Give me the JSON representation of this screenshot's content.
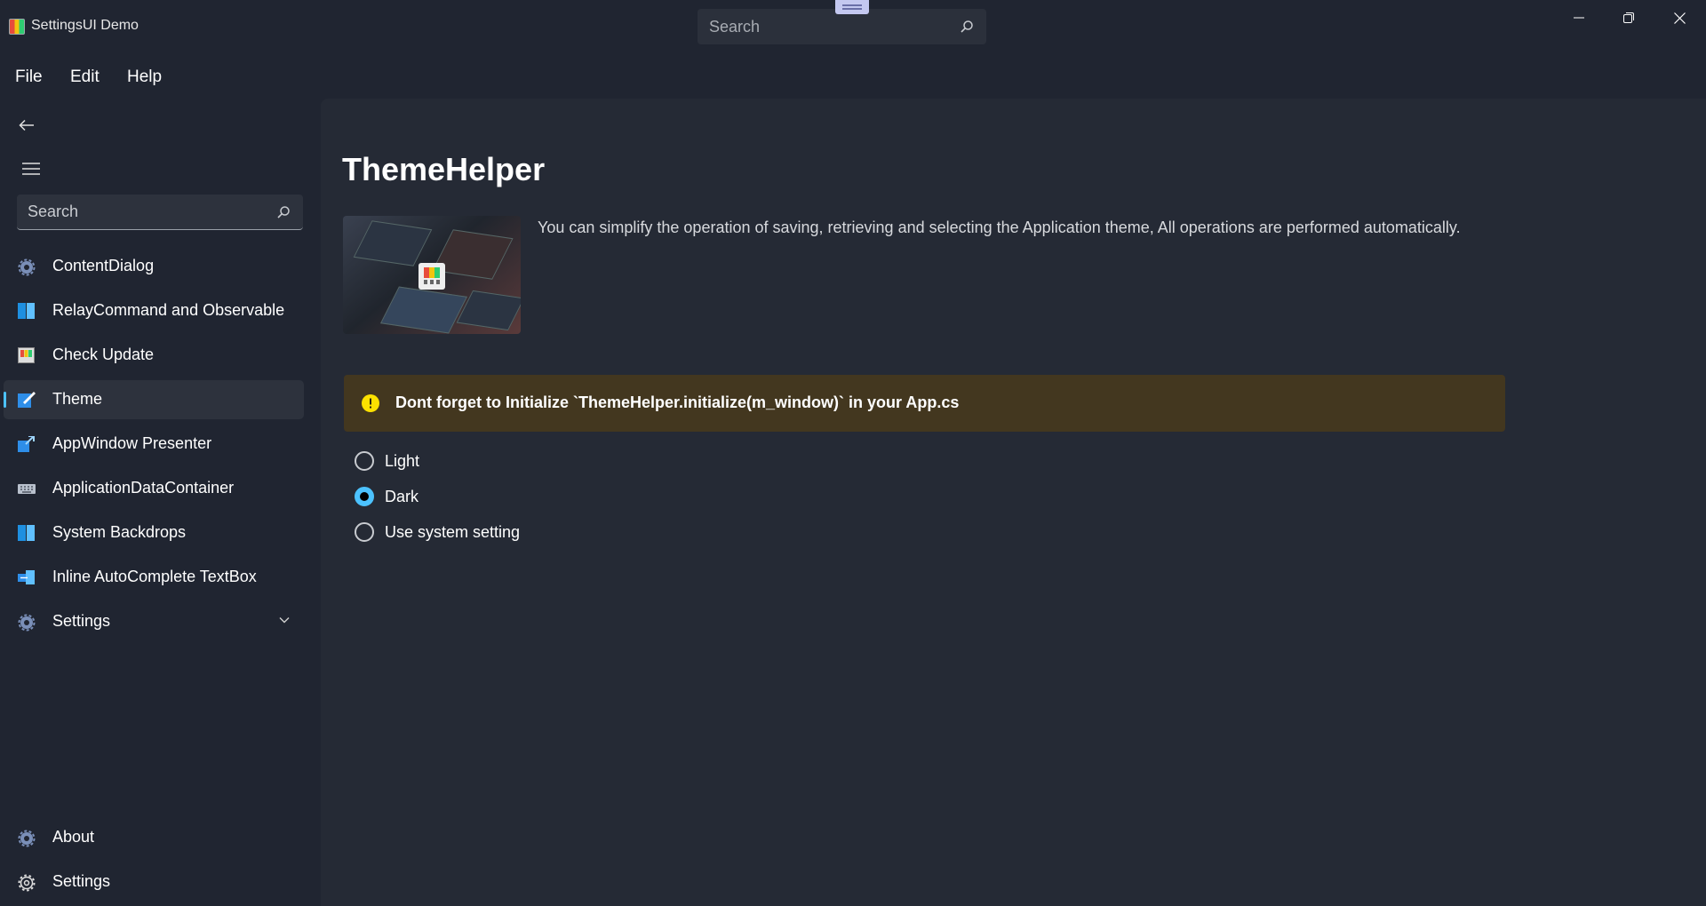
{
  "window": {
    "title": "SettingsUI Demo",
    "search_placeholder": "Search"
  },
  "menu": [
    "File",
    "Edit",
    "Help"
  ],
  "nav": {
    "search_placeholder": "Search",
    "items": [
      {
        "label": "ContentDialog",
        "icon": "gear-icon"
      },
      {
        "label": "RelayCommand and Observable",
        "icon": "blue-square-icon"
      },
      {
        "label": "Check Update",
        "icon": "app-logo-icon"
      },
      {
        "label": "Theme",
        "icon": "theme-brush-icon",
        "selected": true
      },
      {
        "label": "AppWindow Presenter",
        "icon": "window-arrow-icon"
      },
      {
        "label": "ApplicationDataContainer",
        "icon": "keyboard-icon"
      },
      {
        "label": "System Backdrops",
        "icon": "blue-square-icon"
      },
      {
        "label": "Inline AutoComplete TextBox",
        "icon": "textbox-icon"
      },
      {
        "label": "Settings",
        "icon": "gear-icon",
        "expandable": true
      }
    ],
    "footer": [
      {
        "label": "About",
        "icon": "gear-icon"
      },
      {
        "label": "Settings",
        "icon": "gear-outline-icon"
      }
    ]
  },
  "page": {
    "title": "ThemeHelper",
    "description": "You can simplify the operation of saving, retrieving and selecting the Application theme, All operations are performed automatically.",
    "info_message": "Dont forget to Initialize `ThemeHelper.initialize(m_window)` in your App.cs",
    "theme_options": [
      {
        "label": "Light",
        "checked": false
      },
      {
        "label": "Dark",
        "checked": true
      },
      {
        "label": "Use system setting",
        "checked": false
      }
    ]
  },
  "colors": {
    "accent": "#4cc2ff",
    "background": "#202531",
    "content": "#252a35",
    "warning_bar": "#43371f",
    "warning_icon": "#fce100"
  }
}
